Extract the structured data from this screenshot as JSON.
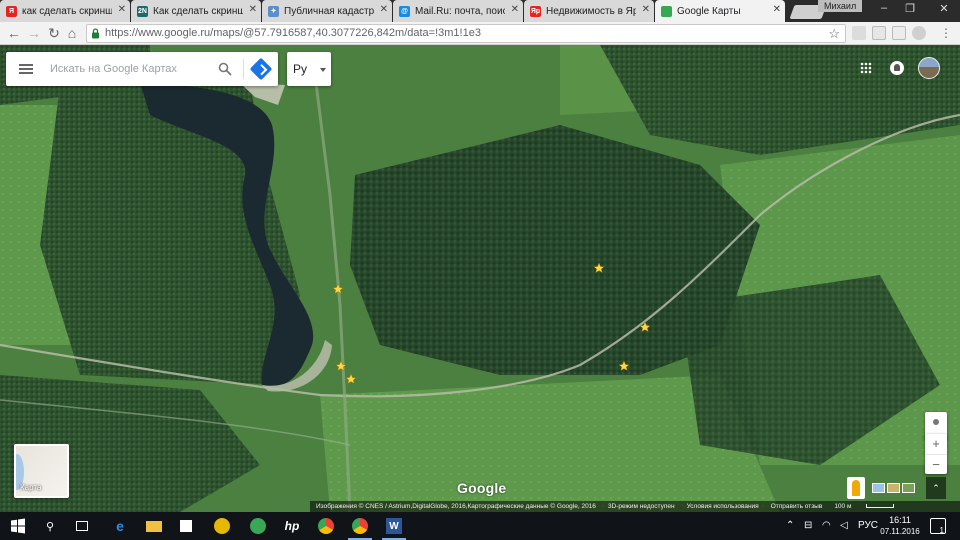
{
  "browser": {
    "tabs": [
      {
        "label": "как сделать скриншот",
        "favicon": "yandex-icon",
        "favicon_text": "Я",
        "color": "#e52620",
        "active": false
      },
      {
        "label": "Как сделать скриншот",
        "favicon": "2n-icon",
        "favicon_text": "2N",
        "color": "#1b6b6b",
        "active": false
      },
      {
        "label": "Публичная кадастров",
        "favicon": "cadastre-icon",
        "favicon_text": "✦",
        "color": "#5b8fc9",
        "active": false
      },
      {
        "label": "Mail.Ru: почта, поиск",
        "favicon": "mailru-icon",
        "favicon_text": "@",
        "color": "#168de2",
        "active": false
      },
      {
        "label": "Недвижимость в Ярос",
        "favicon": "yandex-realty-icon",
        "favicon_text": "Яр",
        "color": "#e52620",
        "active": false
      },
      {
        "label": "Google Карты",
        "favicon": "google-maps-icon",
        "favicon_text": "",
        "color": "#34a853",
        "active": true
      }
    ],
    "user_name": "Михаил",
    "url": "https://www.google.ru/maps/@57.7916587,40.3077226,842m/data=!3m1!1e3"
  },
  "map": {
    "search": {
      "placeholder": "Искать на Google Картах"
    },
    "language": "Ру",
    "map_type_label": "Карта",
    "logo": "Google",
    "footer": {
      "attribution": "Изображения © CNES / Astrium,DigitalGlobe, 2016,Картографические данные © Google, 2016",
      "mode_3d": "3D-режим недоступен",
      "terms": "Условия использования",
      "feedback": "Отправить отзыв",
      "scale": "100 м"
    },
    "zoom": {
      "in": "+",
      "out": "−"
    }
  },
  "taskbar": {
    "language": "РУС",
    "time": "16:11",
    "date": "07.11.2016",
    "notifications": "1"
  }
}
